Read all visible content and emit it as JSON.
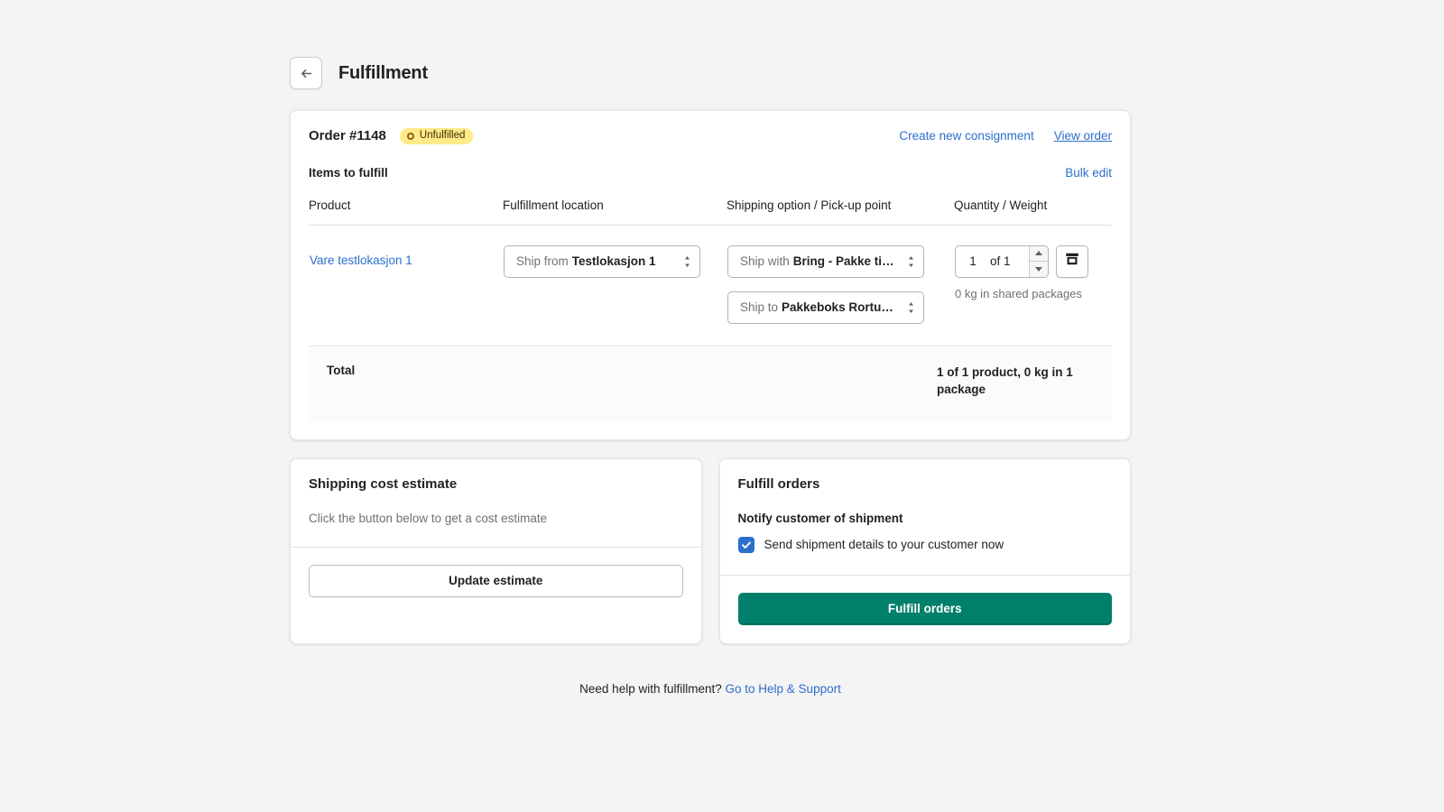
{
  "header": {
    "back_icon": "arrow-left-icon",
    "title": "Fulfillment"
  },
  "order_card": {
    "order_number": "Order #1148",
    "status_badge": {
      "label": "Unfulfilled",
      "icon": "circle-outline-icon",
      "background": "#ffea8a",
      "text_color": "#3d2e00"
    },
    "create_consignment_link": "Create new consignment",
    "view_order_link": "View order",
    "items_title": "Items to fulfill",
    "bulk_edit_link": "Bulk edit",
    "table": {
      "columns": [
        "Product",
        "Fulfillment location",
        "Shipping option / Pick-up point",
        "Quantity / Weight"
      ],
      "rows": [
        {
          "product": "Vare testlokasjon 1",
          "fulfillment_location": {
            "prefix": "Ship from",
            "value": "Testlokasjon 1"
          },
          "shipping_option": {
            "prefix": "Ship with",
            "value": "Bring - Pakke til h..."
          },
          "pickup_point": {
            "prefix": "Ship to",
            "value": "Pakkeboks Rortunet..."
          },
          "quantity": "1",
          "quantity_of": "of 1",
          "package_icon": "package-box-icon",
          "weight_note": "0 kg in shared packages"
        }
      ]
    },
    "total": {
      "label": "Total",
      "value": "1 of 1 product, 0 kg in 1 package"
    }
  },
  "shipping_estimate_card": {
    "title": "Shipping cost estimate",
    "description": "Click the button below to get a cost estimate",
    "button_label": "Update estimate"
  },
  "fulfill_card": {
    "title": "Fulfill orders",
    "notify_label": "Notify customer of shipment",
    "checkbox_label": "Send shipment details to your customer now",
    "checkbox_checked": true,
    "button_label": "Fulfill orders",
    "button_color": "#00806a"
  },
  "footer": {
    "help_text": "Need help with fulfillment?",
    "help_link": "Go to Help & Support"
  },
  "theme": {
    "page_background": "#f4f4f4",
    "link_color": "#2c6ecb",
    "checkbox_color": "#2c6ecb"
  }
}
